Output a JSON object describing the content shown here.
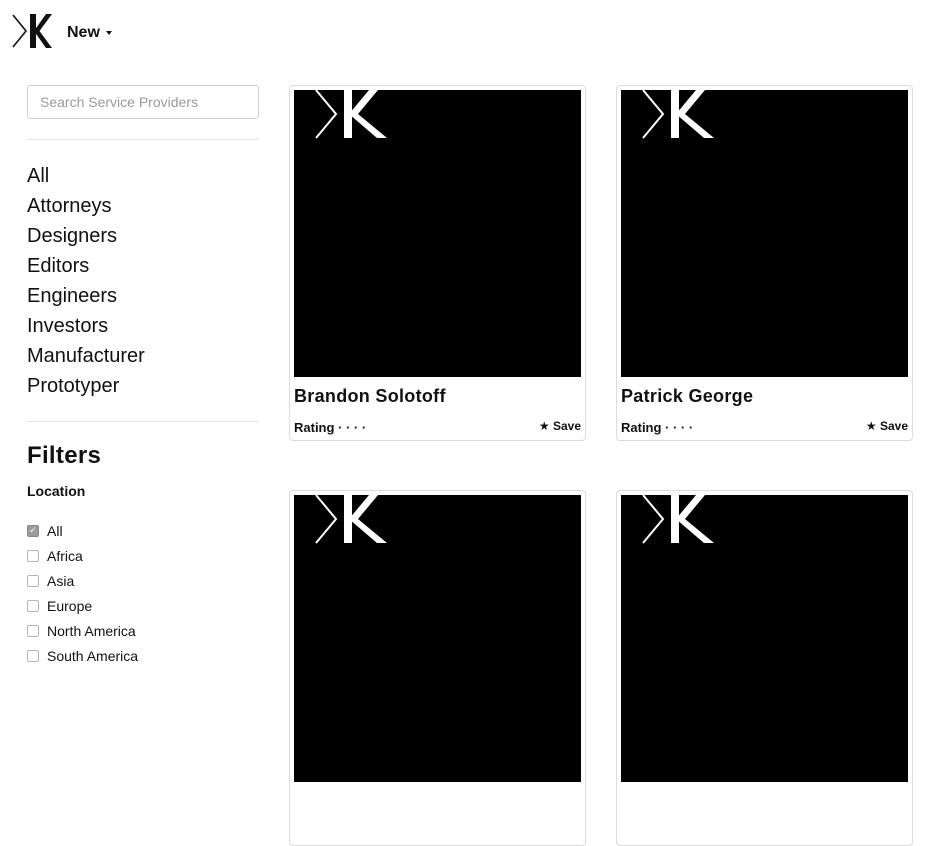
{
  "header": {
    "new_label": "New"
  },
  "search": {
    "placeholder": "Search Service Providers"
  },
  "categories": [
    "All",
    "Attorneys",
    "Designers",
    "Editors",
    "Engineers",
    "Investors",
    "Manufacturer",
    "Prototyper"
  ],
  "filters": {
    "title": "Filters",
    "location_label": "Location",
    "locations": [
      {
        "label": "All",
        "checked": true
      },
      {
        "label": "Africa",
        "checked": false
      },
      {
        "label": "Asia",
        "checked": false
      },
      {
        "label": "Europe",
        "checked": false
      },
      {
        "label": "North America",
        "checked": false
      },
      {
        "label": "South America",
        "checked": false
      }
    ]
  },
  "providers": [
    {
      "name": "Brandon Solotoff",
      "rating_label": "Rating · · · ·",
      "save_label": "★ Save"
    },
    {
      "name": "Patrick George",
      "rating_label": "Rating · · · ·",
      "save_label": "★ Save"
    },
    {
      "name": "",
      "rating_label": "",
      "save_label": ""
    },
    {
      "name": "",
      "rating_label": "",
      "save_label": ""
    }
  ],
  "colors": {
    "thumb_bg": "#000000",
    "accent": "#111111"
  }
}
